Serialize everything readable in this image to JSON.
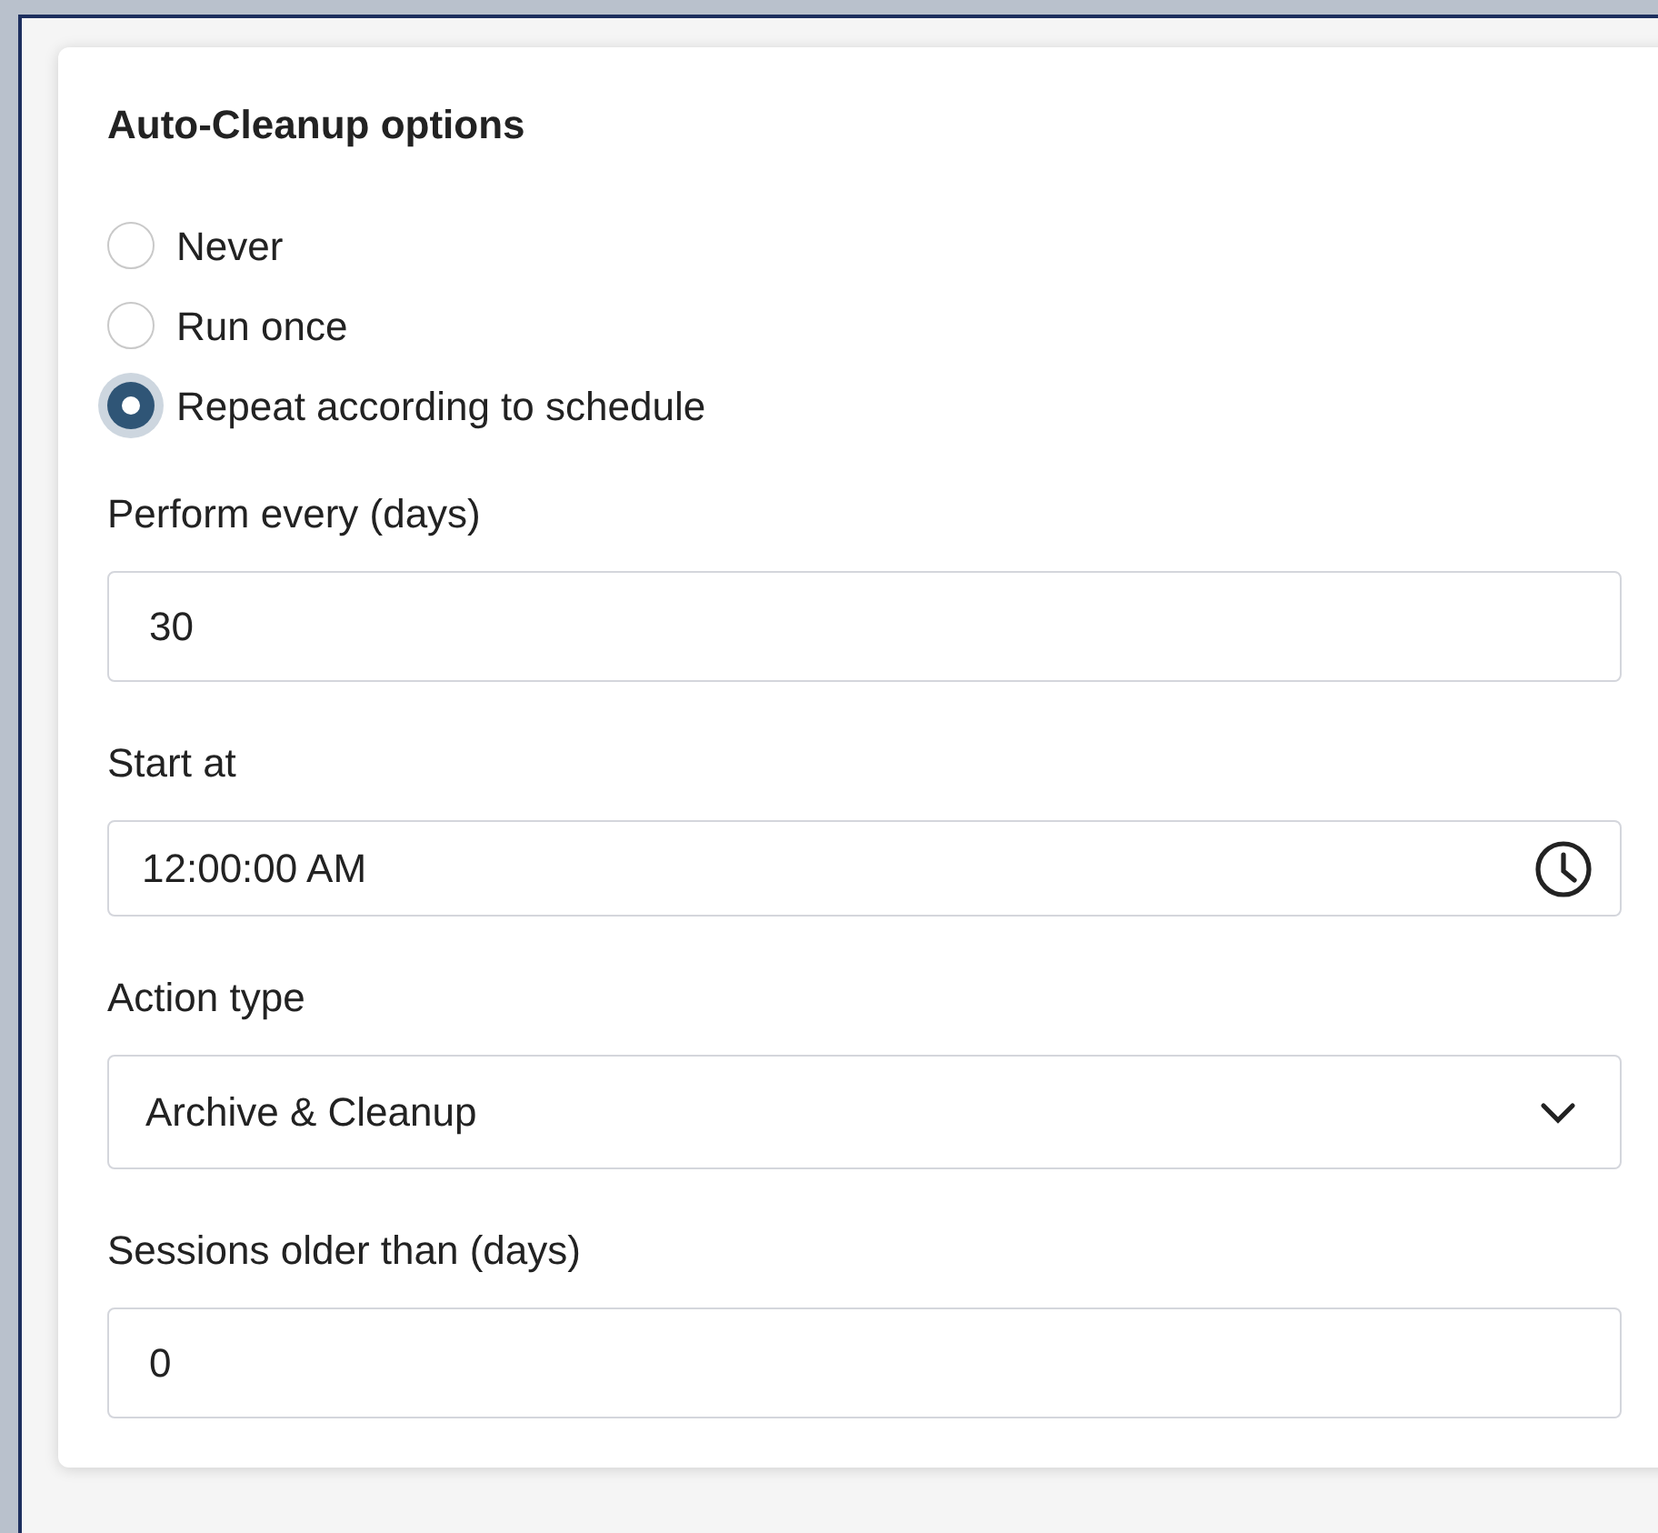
{
  "title": "Auto-Cleanup options",
  "options": [
    {
      "label": "Never",
      "selected": false
    },
    {
      "label": "Run once",
      "selected": false
    },
    {
      "label": "Repeat according to schedule",
      "selected": true
    }
  ],
  "fields": [
    {
      "kind": "number",
      "label": "Perform every (days)",
      "value": "30"
    },
    {
      "kind": "time",
      "label": "Start at",
      "value": "12:00:00 AM"
    },
    {
      "kind": "select",
      "label": "Action type",
      "value": "Archive & Cleanup"
    },
    {
      "kind": "number",
      "label": "Sessions older than (days)",
      "value": "0"
    }
  ]
}
